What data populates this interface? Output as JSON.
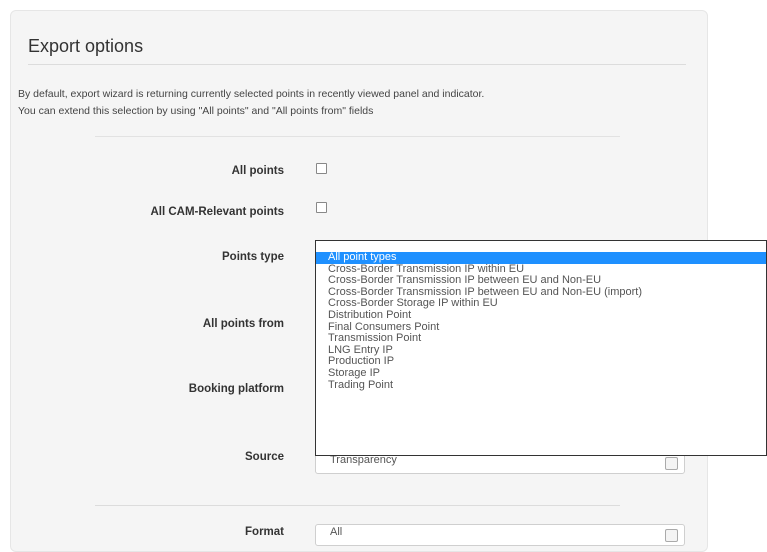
{
  "panel": {
    "title": "Export options",
    "description_line1": "By default, export wizard is returning currently selected points in recently viewed panel and indicator.",
    "description_line2": "You can extend this selection by using \"All points\" and \"All points from\" fields"
  },
  "form": {
    "all_points_label": "All points",
    "all_cam_label": "All CAM-Relevant points",
    "points_type_label": "Points type",
    "all_points_from_label": "All points from",
    "booking_platform_label": "Booking platform",
    "source_label": "Source",
    "source_value": "Transparency",
    "next_label": "Format",
    "next_value": "All"
  },
  "dropdown": {
    "options": [
      "All point types",
      "Cross-Border Transmission IP within EU",
      "Cross-Border Transmission IP between EU and Non-EU",
      "Cross-Border Transmission IP between EU and Non-EU (import)",
      "Cross-Border Storage IP within EU",
      "Distribution Point",
      "Final Consumers Point",
      "Transmission Point",
      "LNG Entry IP",
      "Production IP",
      "Storage IP",
      "Trading Point"
    ],
    "selected_index": 0
  },
  "colors": {
    "selected_option_bg": "#1e90ff",
    "panel_bg": "#f5f5f5"
  }
}
